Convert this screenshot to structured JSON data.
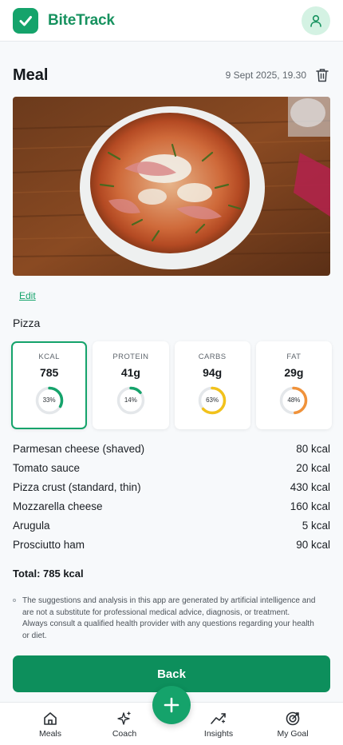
{
  "app": {
    "brand": "BiteTrack"
  },
  "meal": {
    "title": "Meal",
    "datetime": "9 Sept 2025, 19.30",
    "edit_label": "Edit",
    "name": "Pizza"
  },
  "macros": [
    {
      "label": "KCAL",
      "value": "785",
      "percent": 33,
      "percent_label": "33%",
      "color": "#15a36b",
      "selected": true
    },
    {
      "label": "PROTEIN",
      "value": "41g",
      "percent": 14,
      "percent_label": "14%",
      "color": "#15a36b",
      "selected": false
    },
    {
      "label": "CARBS",
      "value": "94g",
      "percent": 63,
      "percent_label": "63%",
      "color": "#f2c21b",
      "selected": false
    },
    {
      "label": "FAT",
      "value": "29g",
      "percent": 48,
      "percent_label": "48%",
      "color": "#f0923a",
      "selected": false
    }
  ],
  "items": [
    {
      "name": "Parmesan cheese (shaved)",
      "kcal": "80 kcal"
    },
    {
      "name": "Tomato sauce",
      "kcal": "20 kcal"
    },
    {
      "name": "Pizza crust (standard, thin)",
      "kcal": "430 kcal"
    },
    {
      "name": "Mozzarella cheese",
      "kcal": "160 kcal"
    },
    {
      "name": "Arugula",
      "kcal": "5 kcal"
    },
    {
      "name": "Prosciutto ham",
      "kcal": "90 kcal"
    }
  ],
  "total": "Total: 785 kcal",
  "disclaimer": "The suggestions and analysis in this app are generated by artificial intelligence and are not a substitute for professional medical advice, diagnosis, or treatment. Always consult a qualified health provider with any questions regarding your health or diet.",
  "back_label": "Back",
  "nav": {
    "meals": "Meals",
    "coach": "Coach",
    "insights": "Insights",
    "goal": "My Goal"
  },
  "colors": {
    "accent": "#15a36b",
    "accent_dark": "#0d8f5c"
  }
}
